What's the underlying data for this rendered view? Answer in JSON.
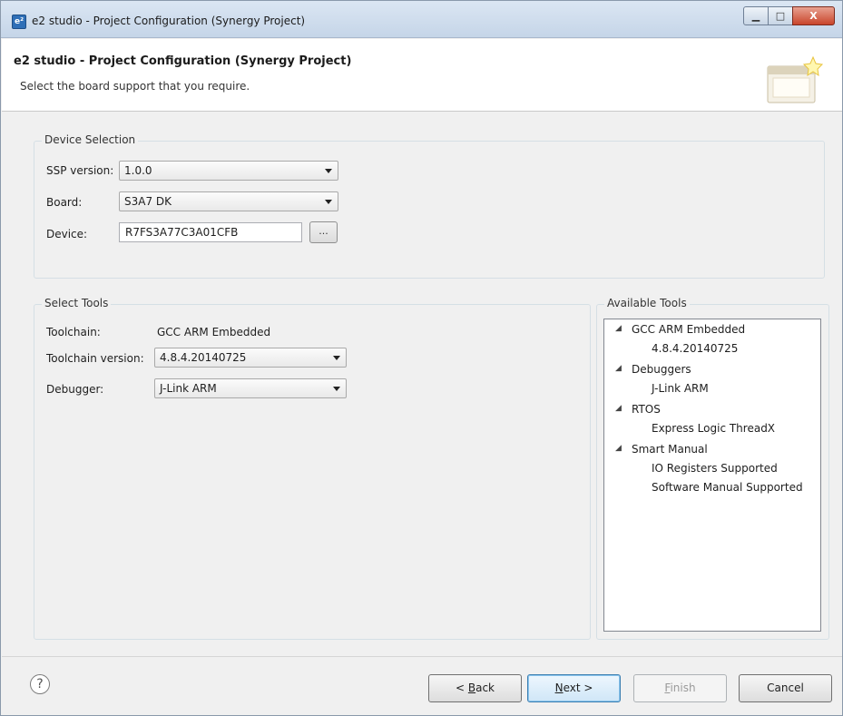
{
  "window": {
    "title": "e2 studio - Project Configuration  (Synergy Project)",
    "app_icon": "e²",
    "minimize": "▁",
    "maximize": "□",
    "close": "X"
  },
  "banner": {
    "title": "e2 studio - Project Configuration  (Synergy Project)",
    "subtitle": "Select the board support that you require."
  },
  "device_selection": {
    "legend": "Device Selection",
    "ssp_label": "SSP version:",
    "ssp_value": "1.0.0",
    "board_label": "Board:",
    "board_value": "S3A7 DK",
    "device_label": "Device:",
    "device_value": "R7FS3A77C3A01CFB",
    "browse_label": "..."
  },
  "select_tools": {
    "legend": "Select Tools",
    "toolchain_label": "Toolchain:",
    "toolchain_value": "GCC ARM Embedded",
    "toolchain_version_label": "Toolchain version:",
    "toolchain_version_value": "4.8.4.20140725",
    "debugger_label": "Debugger:",
    "debugger_value": "J-Link ARM"
  },
  "available_tools": {
    "legend": "Available Tools",
    "items": [
      {
        "label": "GCC ARM Embedded",
        "children": [
          "4.8.4.20140725"
        ]
      },
      {
        "label": "Debuggers",
        "children": [
          "J-Link ARM"
        ]
      },
      {
        "label": "RTOS",
        "children": [
          "Express Logic ThreadX"
        ]
      },
      {
        "label": "Smart Manual",
        "children": [
          "IO Registers Supported",
          "Software Manual Supported"
        ]
      }
    ]
  },
  "buttons": {
    "help": "?",
    "back_prefix": "< ",
    "back_mnemonic": "B",
    "back_rest": "ack",
    "next_mnemonic": "N",
    "next_rest": "ext >",
    "finish_mnemonic": "F",
    "finish_rest": "inish",
    "cancel": "Cancel"
  }
}
